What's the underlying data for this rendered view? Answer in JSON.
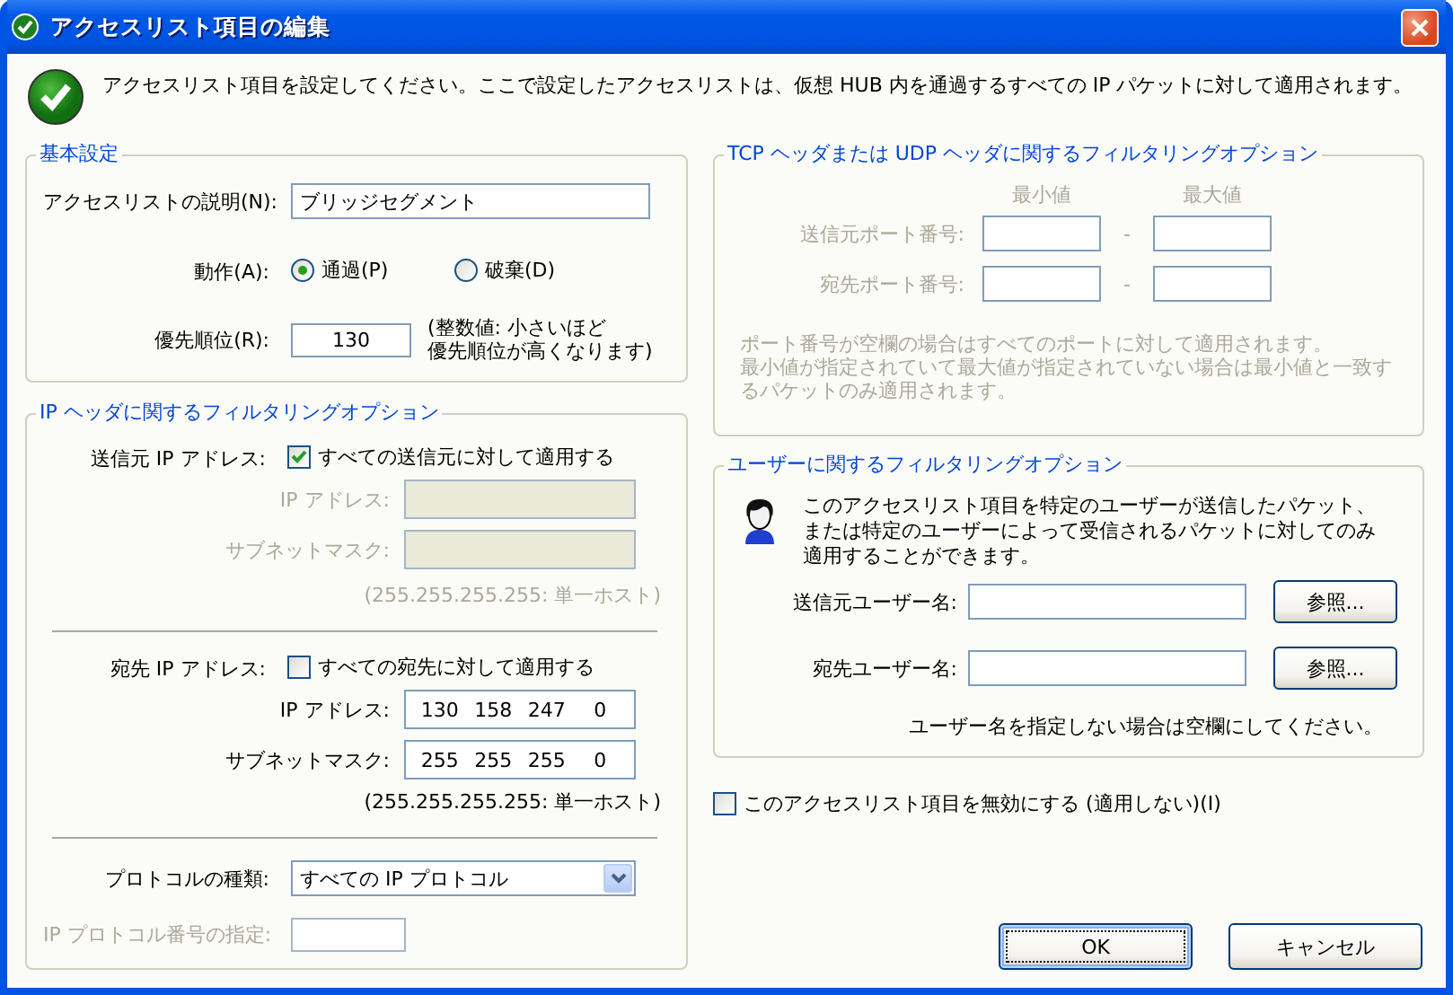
{
  "window": {
    "title": "アクセスリスト項目の編集"
  },
  "intro": "アクセスリスト項目を設定してください。ここで設定したアクセスリストは、仮想 HUB 内を通過するすべての IP パケットに対して適用されます。",
  "basic": {
    "title": "基本設定",
    "description": {
      "label": "アクセスリストの説明(N):",
      "value": "ブリッジセグメント"
    },
    "action": {
      "label": "動作(A):",
      "options": [
        {
          "label": "通過(P)",
          "selected": true
        },
        {
          "label": "破棄(D)",
          "selected": false
        }
      ]
    },
    "priority": {
      "label": "優先順位(R):",
      "value": "130",
      "note_lines": [
        "(整数値: 小さいほど",
        "優先順位が高くなります)"
      ]
    }
  },
  "ip_filter": {
    "title": "IP ヘッダに関するフィルタリングオプション",
    "sections": [
      {
        "label": "送信元 IP アドレス:",
        "all": {
          "label": "すべての送信元に対して適用する",
          "checked": true
        },
        "disabled": true,
        "fields": [
          {
            "label": "IP アドレス:"
          },
          {
            "label": "サブネットマスク:"
          }
        ],
        "note": "(255.255.255.255: 単一ホスト)"
      },
      {
        "label": "宛先 IP アドレス:",
        "all": {
          "label": "すべての宛先に対して適用する",
          "checked": false
        },
        "disabled": false,
        "fields": [
          {
            "label": "IP アドレス:",
            "octets": [
              "130",
              "158",
              "247",
              "0"
            ]
          },
          {
            "label": "サブネットマスク:",
            "octets": [
              "255",
              "255",
              "255",
              "0"
            ]
          }
        ],
        "note": "(255.255.255.255: 単一ホスト)"
      }
    ],
    "protocol": {
      "label": "プロトコルの種類:",
      "value": "すべての IP プロトコル"
    },
    "protocol_number": {
      "label": "IP プロトコル番号の指定:",
      "disabled": true
    }
  },
  "tcp_udp_filter": {
    "title": "TCP ヘッダまたは UDP ヘッダに関するフィルタリングオプション",
    "disabled": true,
    "min_heading": "最小値",
    "max_heading": "最大値",
    "rows": [
      {
        "label": "送信元ポート番号:",
        "separator": "-"
      },
      {
        "label": "宛先ポート番号:",
        "separator": "-"
      }
    ],
    "notes": [
      "ポート番号が空欄の場合はすべてのポートに対して適用されます。",
      "最小値が指定されていて最大値が指定されていない場合は最小値と一致するパケットのみ適用されます。"
    ]
  },
  "user_filter": {
    "title": "ユーザーに関するフィルタリングオプション",
    "text": "このアクセスリスト項目を特定のユーザーが送信したパケット、または特定のユーザーによって受信されるパケットに対してのみ適用することができます。",
    "rows": [
      {
        "label": "送信元ユーザー名:",
        "button": "参照..."
      },
      {
        "label": "宛先ユーザー名:",
        "button": "参照..."
      }
    ],
    "note": "ユーザー名を指定しない場合は空欄にしてください。"
  },
  "disable_entry": {
    "label": "このアクセスリスト項目を無効にする (適用しない)(I)",
    "checked": false
  },
  "buttons": [
    {
      "label": "OK",
      "kind": "default"
    },
    {
      "label": "キャンセル",
      "kind": "normal"
    }
  ]
}
